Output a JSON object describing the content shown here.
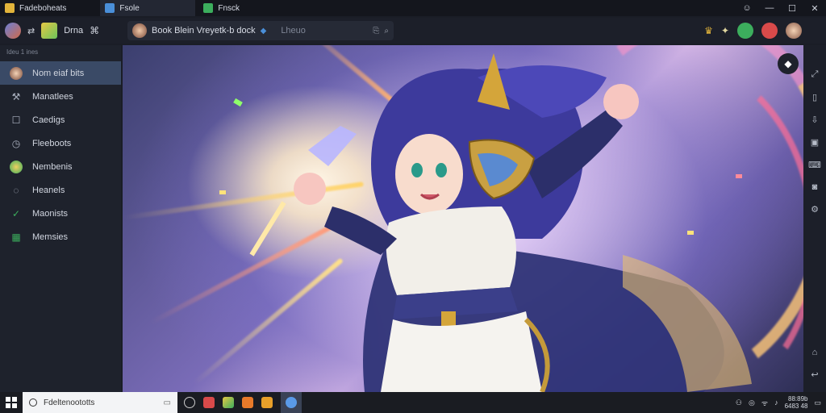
{
  "titlebar": {
    "tabs": [
      {
        "label": "Fadeboheats",
        "icon": "game-icon",
        "color": "#e2b43b"
      },
      {
        "label": "Fsole",
        "icon": "app-icon",
        "color": "#4a8fd9"
      },
      {
        "label": "Fnsck",
        "icon": "leaf-icon",
        "color": "#3cae5d"
      }
    ],
    "controls": [
      "☺",
      "—",
      "☐",
      "✕"
    ]
  },
  "toolbar": {
    "left_label": "Drna",
    "address": "Book Blein Vreyetk-b dock",
    "address_hint": "Lheuo"
  },
  "sidebar": {
    "heading": "Ideu 1 ines",
    "items": [
      {
        "label": "Nom eiaf bits",
        "icon": "avatar-icon",
        "active": true
      },
      {
        "label": "Manatlees",
        "icon": "tools-icon",
        "active": false
      },
      {
        "label": "Caedigs",
        "icon": "square-icon",
        "active": false
      },
      {
        "label": "Fleeboots",
        "icon": "clock-icon",
        "active": false
      },
      {
        "label": "Nembenis",
        "icon": "globe-icon",
        "active": false
      },
      {
        "label": "Heanels",
        "icon": "circle-icon",
        "active": false
      },
      {
        "label": "Maonists",
        "icon": "check-icon",
        "active": false
      },
      {
        "label": "Memsies",
        "icon": "grid-icon",
        "active": false
      }
    ]
  },
  "taskbar": {
    "search_placeholder": "Fdeltenoototts",
    "clock_line1": "88:89b",
    "clock_line2": "6483 48",
    "accent": "#3a4256"
  }
}
